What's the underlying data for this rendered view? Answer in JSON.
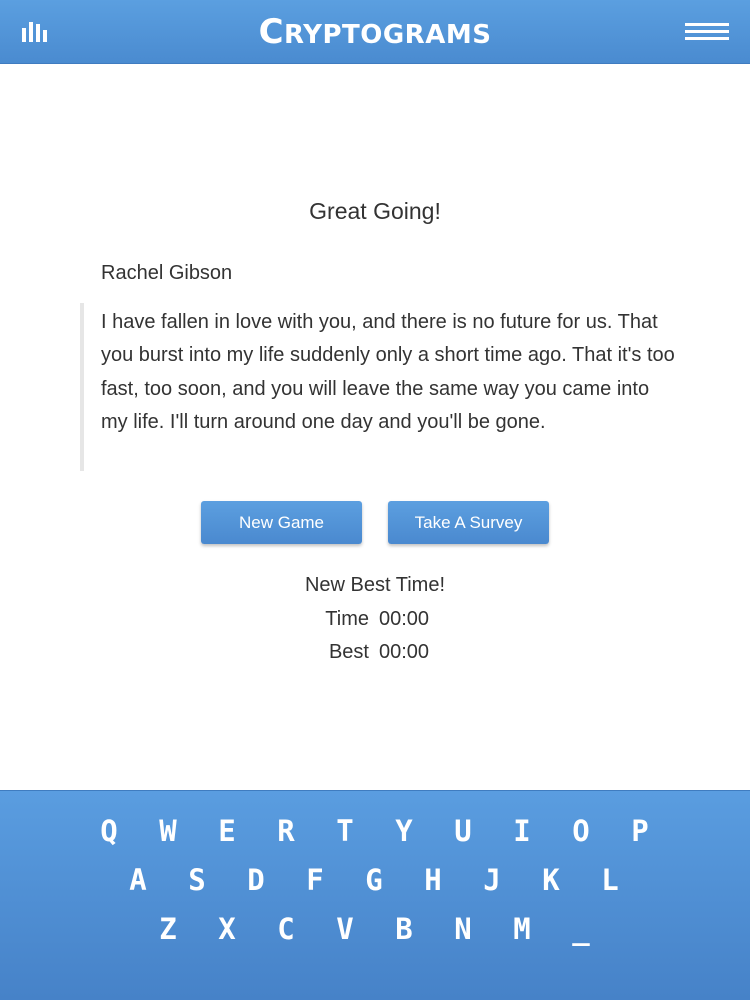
{
  "header": {
    "title_first": "C",
    "title_rest": "RYPTOGRAMS",
    "stats_icon": "bar-chart-icon",
    "menu_icon": "hamburger-menu-icon"
  },
  "result": {
    "heading": "Great Going!",
    "author": "Rachel Gibson",
    "quote": "I have fallen in love with you, and there is no future for us. That you burst into my life suddenly only a short time ago. That it's too fast, too soon, and you will leave the same way you came into my life. I'll turn around one day and you'll be gone."
  },
  "buttons": {
    "new_game": "New Game",
    "survey": "Take A Survey"
  },
  "stats": {
    "best_message": "New Best Time!",
    "time_label": "Time",
    "time_value": "00:00",
    "best_label": "Best",
    "best_value": "00:00"
  },
  "keyboard": {
    "rows": [
      [
        "Q",
        "W",
        "E",
        "R",
        "T",
        "Y",
        "U",
        "I",
        "O",
        "P"
      ],
      [
        "A",
        "S",
        "D",
        "F",
        "G",
        "H",
        "J",
        "K",
        "L"
      ],
      [
        "Z",
        "X",
        "C",
        "V",
        "B",
        "N",
        "M",
        "_"
      ]
    ]
  },
  "colors": {
    "header_blue": "#4a8bd0",
    "button_blue": "#4a89cf",
    "keyboard_blue": "#4682c8"
  }
}
